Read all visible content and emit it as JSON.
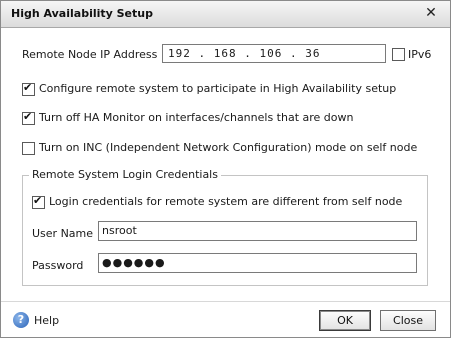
{
  "window": {
    "title": "High Availability Setup"
  },
  "form": {
    "remote_ip_label": "Remote Node IP Address",
    "remote_ip_value": "192 . 168 . 106 . 36",
    "ipv6_label": "IPv6",
    "ipv6_checked": false,
    "configure_remote_label": "Configure remote system to participate in High Availability setup",
    "configure_remote_checked": true,
    "turn_off_ha_label": "Turn off HA Monitor on interfaces/channels that are down",
    "turn_off_ha_checked": true,
    "turn_on_inc_label": "Turn on INC (Independent Network Configuration) mode on self node",
    "turn_on_inc_checked": false
  },
  "credentials": {
    "group_title": "Remote System Login Credentials",
    "different_label": "Login credentials for remote system are different from self node",
    "different_checked": true,
    "username_label": "User Name",
    "username_value": "nsroot",
    "password_label": "Password",
    "password_masked": "●●●●●●"
  },
  "footer": {
    "help_label": "Help",
    "ok_label": "OK",
    "close_label": "Close"
  }
}
